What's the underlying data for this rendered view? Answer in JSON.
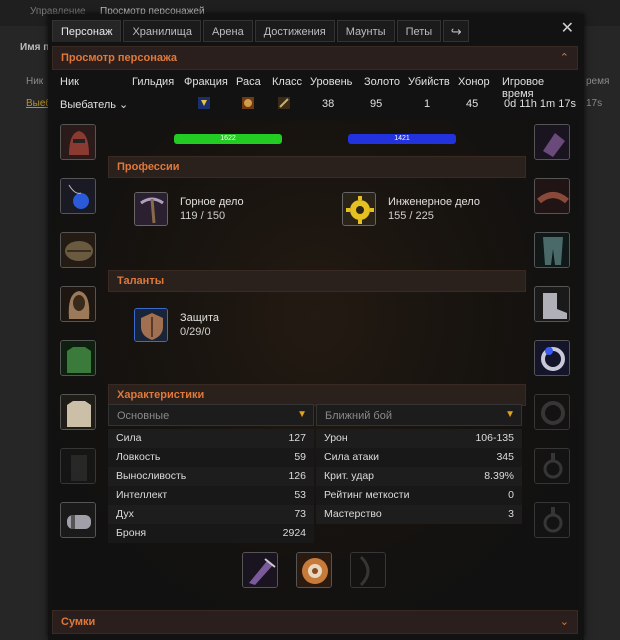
{
  "background": {
    "tab_manage": "Управление",
    "tab_view": "Просмотр персонажей",
    "name_label": "Имя п",
    "nick_label": "Ник",
    "nick_link": "Выеб",
    "time_label": "ремя",
    "time_value": "17s"
  },
  "tabs": [
    {
      "label": "Персонаж"
    },
    {
      "label": "Хранилища"
    },
    {
      "label": "Арена"
    },
    {
      "label": "Достижения"
    },
    {
      "label": "Маунты"
    },
    {
      "label": "Петы"
    }
  ],
  "close_label": "✕",
  "share_icon": "↪",
  "header_section": {
    "title": "Просмотр персонажа",
    "chevron": "⌃"
  },
  "table": {
    "headers": [
      "Ник",
      "Гильдия",
      "Фракция",
      "Раса",
      "Класс",
      "Уровень",
      "Золото",
      "Убийств",
      "Хонор",
      "Игровое время"
    ],
    "row": {
      "nick": "Выебатель",
      "guild": "",
      "level": "38",
      "gold": "95",
      "kills": "1",
      "honor": "45",
      "playtime": "0d 11h 1m 17s"
    }
  },
  "bars": {
    "health_value": "1622",
    "mana_value": "1421",
    "health_color": "#22cc22",
    "mana_color": "#2233dd"
  },
  "professions": {
    "title": "Профессии",
    "items": [
      {
        "name": "Горное дело",
        "value": "119 / 150",
        "icon": "pickaxe-icon"
      },
      {
        "name": "Инженерное дело",
        "value": "155 / 225",
        "icon": "gear-icon"
      }
    ]
  },
  "talents": {
    "title": "Таланты",
    "items": [
      {
        "name": "Защита",
        "value": "0/29/0",
        "icon": "shield-icon"
      }
    ]
  },
  "stats": {
    "title": "Характеристики",
    "left": {
      "selected": "Основные",
      "rows": [
        {
          "label": "Сила",
          "value": "127"
        },
        {
          "label": "Ловкость",
          "value": "59"
        },
        {
          "label": "Выносливость",
          "value": "126"
        },
        {
          "label": "Интеллект",
          "value": "53"
        },
        {
          "label": "Дух",
          "value": "73"
        },
        {
          "label": "Броня",
          "value": "2924"
        }
      ]
    },
    "right": {
      "selected": "Ближний бой",
      "rows": [
        {
          "label": "Урон",
          "value": "106-135"
        },
        {
          "label": "Сила атаки",
          "value": "345"
        },
        {
          "label": "Крит. удар",
          "value": "8.39%"
        },
        {
          "label": "Рейтинг меткости",
          "value": "0"
        },
        {
          "label": "Мастерство",
          "value": "3"
        }
      ]
    }
  },
  "bags": {
    "title": "Сумки",
    "chevron": "⌄"
  },
  "equipment": {
    "left": [
      "helmet-icon",
      "amulet-icon",
      "shoulders-icon",
      "cloak-icon",
      "chest-icon",
      "shirt-icon",
      "tabard-icon",
      "bracers-icon"
    ],
    "right": [
      "gloves-icon",
      "belt-icon",
      "legs-icon",
      "boots-icon",
      "ring-icon",
      "ring-empty-icon",
      "trinket-empty-icon",
      "trinket-empty-icon"
    ],
    "bottom": [
      "mainhand-icon",
      "offhand-shield-icon",
      "ranged-empty-icon"
    ]
  }
}
